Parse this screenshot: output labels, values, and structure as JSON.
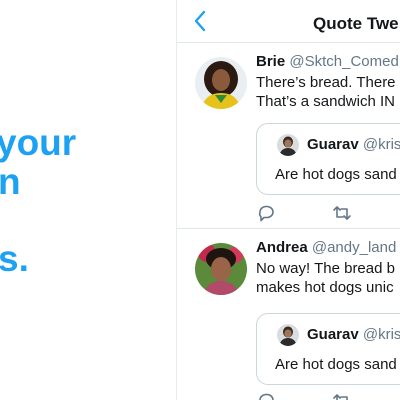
{
  "promo": {
    "line1": "your",
    "line2": "n",
    "line3": "s."
  },
  "nav": {
    "back_icon": "chevron-left-icon",
    "title": "Quote Twe"
  },
  "tweets": [
    {
      "name": "Brie",
      "handle": "@Sktch_Comed",
      "text_line1": "There’s bread. There",
      "text_line2": "That’s a sandwich IN",
      "quote": {
        "name": "Guarav",
        "handle": "@kris",
        "text": "Are hot dogs sand"
      },
      "actions": [
        "reply-icon",
        "retweet-icon"
      ]
    },
    {
      "name": "Andrea",
      "handle": "@andy_land",
      "text_line1": "No way! The bread b",
      "text_line2": "makes hot dogs unic",
      "quote": {
        "name": "Guarav",
        "handle": "@kris",
        "text": "Are hot dogs sand"
      },
      "actions": [
        "reply-icon",
        "retweet-icon"
      ]
    }
  ],
  "colors": {
    "accent": "#1da1f2",
    "text": "#14171a",
    "muted": "#657786",
    "border": "#e1e8ed"
  }
}
